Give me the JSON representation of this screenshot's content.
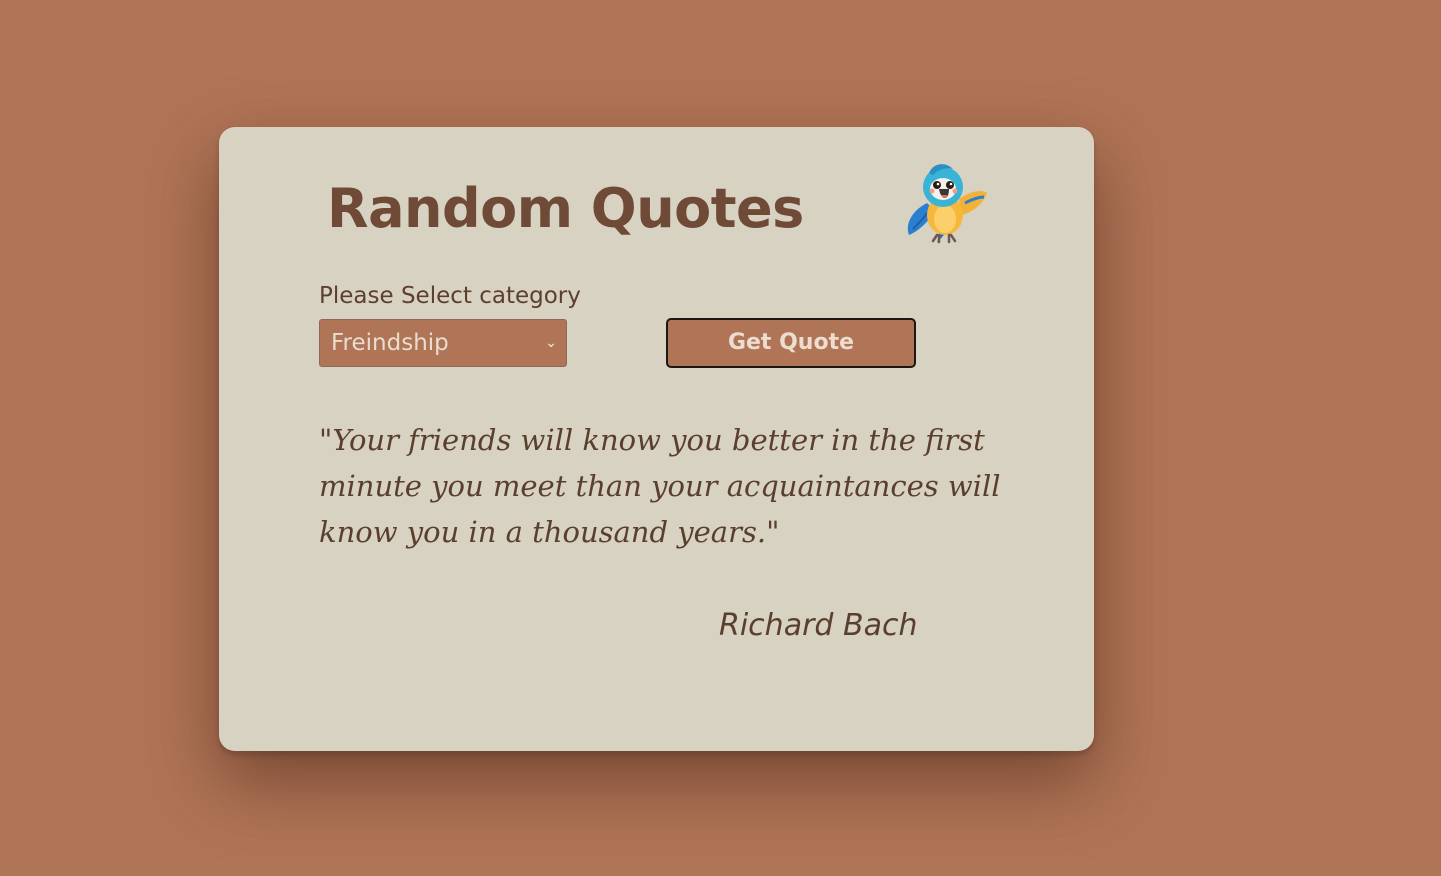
{
  "app": {
    "title": "Random Quotes",
    "mascot_icon": "parrot-icon"
  },
  "controls": {
    "select_label": "Please Select category",
    "category_selected": "Freindship",
    "get_quote_label": "Get Quote"
  },
  "quote": {
    "text": "\"Your friends will know you better in the first minute you meet than your acquaintances will know you in a thousand years.\"",
    "author": "Richard Bach"
  },
  "colors": {
    "background": "#b07456",
    "card": "#d8d2c2",
    "title": "#6f4a36",
    "button": "#b07456"
  }
}
